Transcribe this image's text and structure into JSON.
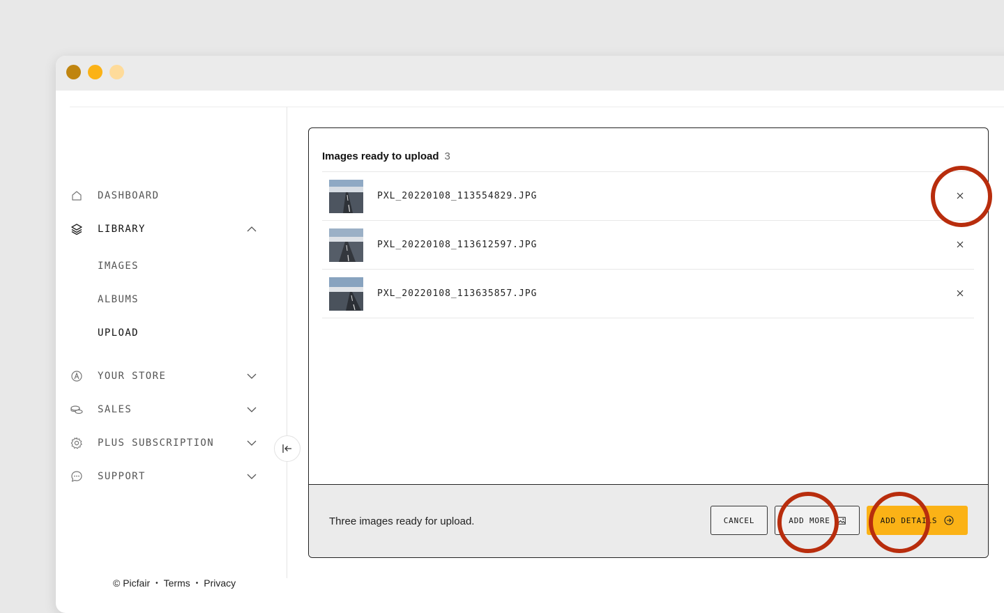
{
  "sidebar": {
    "items": [
      {
        "label": "DASHBOARD",
        "icon": "home-icon"
      },
      {
        "label": "LIBRARY",
        "icon": "layers-icon",
        "expanded": true
      },
      {
        "label": "YOUR STORE",
        "icon": "store-icon"
      },
      {
        "label": "SALES",
        "icon": "coins-icon"
      },
      {
        "label": "PLUS SUBSCRIPTION",
        "icon": "gear-icon"
      },
      {
        "label": "SUPPORT",
        "icon": "chat-icon"
      }
    ],
    "library_sub": [
      "IMAGES",
      "ALBUMS",
      "UPLOAD"
    ],
    "current_sub": "UPLOAD",
    "footer": {
      "copyright": "© Picfair",
      "terms": "Terms",
      "privacy": "Privacy"
    }
  },
  "upload": {
    "title": "Images ready to upload",
    "count": "3",
    "files": [
      {
        "name": "PXL_20220108_113554829.JPG"
      },
      {
        "name": "PXL_20220108_113612597.JPG"
      },
      {
        "name": "PXL_20220108_113635857.JPG"
      }
    ],
    "status_message": "Three images ready for upload.",
    "buttons": {
      "cancel": "CANCEL",
      "add_more": "ADD MORE",
      "add_details": "ADD DETAILS"
    }
  },
  "colors": {
    "accent": "#fbb216",
    "highlight_ring": "#b82d0d"
  }
}
